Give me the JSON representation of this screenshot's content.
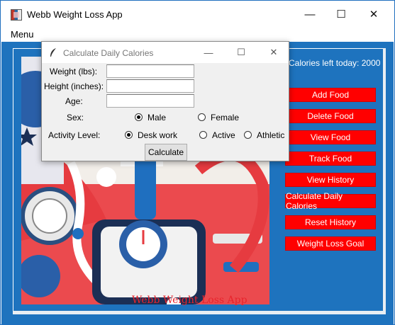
{
  "window": {
    "title": "Webb Weight Loss App",
    "minimize_glyph": "—",
    "maximize_glyph": "☐",
    "close_glyph": "✕"
  },
  "menu": {
    "label": "Menu"
  },
  "main": {
    "calories_left": "Calories left today: 2000",
    "image_caption": "Webb Weight Loss App",
    "buttons": [
      "Add Food",
      "Delete Food",
      "View Food",
      "Track Food",
      "View History",
      "Calculate Daily Calories",
      "Reset History",
      "Weight Loss Goal"
    ]
  },
  "dialog": {
    "title": "Calculate Daily Calories",
    "icon": "feather-icon",
    "minimize_glyph": "—",
    "maximize_glyph": "☐",
    "close_glyph": "✕",
    "weight_label": "Weight (lbs):",
    "weight_value": "",
    "height_label": "Height (inches):",
    "height_value": "",
    "age_label": "Age:",
    "age_value": "",
    "sex_label": "Sex:",
    "sex_options": [
      "Male",
      "Female"
    ],
    "sex_selected": "Male",
    "activity_label": "Activity Level:",
    "activity_options": [
      "Desk work",
      "Active",
      "Athletic"
    ],
    "activity_selected": "Desk work",
    "calculate_label": "Calculate"
  },
  "colors": {
    "background": "#1e73be",
    "button_red": "#ff0000",
    "caption_red": "#e8242c"
  }
}
